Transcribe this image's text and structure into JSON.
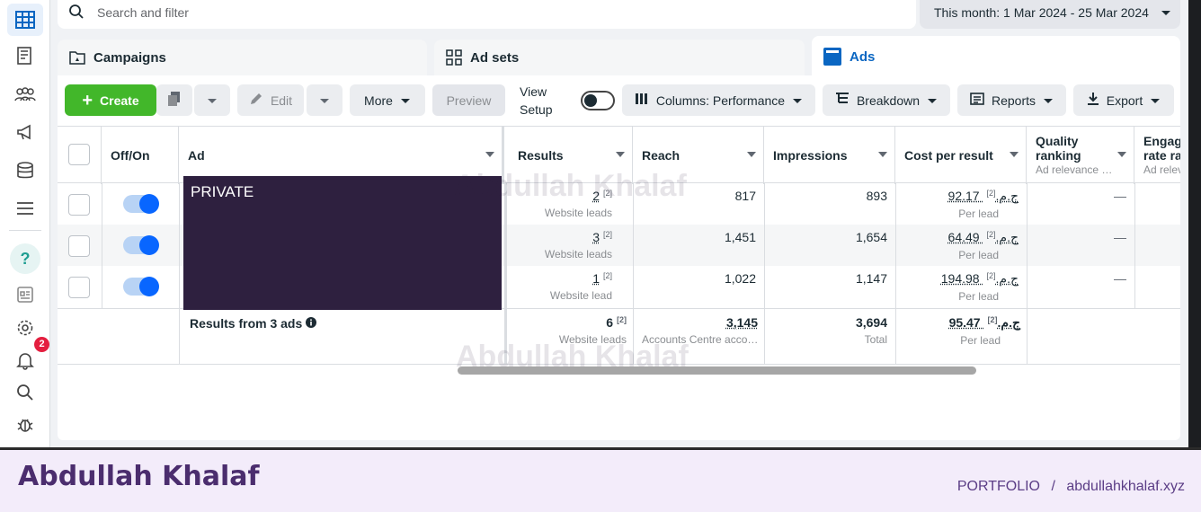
{
  "search": {
    "placeholder": "Search and filter"
  },
  "date_range": {
    "label": "This month: 1 Mar 2024 - 25 Mar 2024"
  },
  "tabs": [
    {
      "label": "Campaigns"
    },
    {
      "label": "Ad sets"
    },
    {
      "label": "Ads"
    }
  ],
  "toolbar": {
    "create": "Create",
    "edit": "Edit",
    "more": "More",
    "preview": "Preview",
    "view_setup": "View Setup",
    "columns": "Columns: Performance",
    "breakdown": "Breakdown",
    "reports": "Reports",
    "export": "Export"
  },
  "nav": {
    "notifications_count": "2"
  },
  "columns": {
    "off_on": "Off/On",
    "ad": "Ad",
    "results": "Results",
    "reach": "Reach",
    "impressions": "Impressions",
    "cost_per_result": "Cost per result",
    "quality": "Quality ranking",
    "quality_sub": "Ad relevance …",
    "engagement": "Engage rate ra",
    "engagement_sub": "Ad relev"
  },
  "private_label": "PRIVATE",
  "rows": [
    {
      "results": "2",
      "results_sub": "Website leads",
      "reach": "817",
      "impressions": "893",
      "cost": "92.17 ج.م.‏",
      "cost_sub": "Per lead",
      "quality": "—"
    },
    {
      "results": "3",
      "results_sub": "Website leads",
      "reach": "1,451",
      "impressions": "1,654",
      "cost": "64.49 ج.م.‏",
      "cost_sub": "Per lead",
      "quality": "—"
    },
    {
      "results": "1",
      "results_sub": "Website lead",
      "reach": "1,022",
      "impressions": "1,147",
      "cost": "194.98 ج.م.‏",
      "cost_sub": "Per lead",
      "quality": "—"
    }
  ],
  "footnote": "[2]",
  "totals": {
    "label": "Results from 3 ads",
    "results": "6",
    "results_sub": "Website leads",
    "reach": "3,145",
    "reach_sub": "Accounts Centre acco…",
    "impressions": "3,694",
    "impressions_sub": "Total",
    "cost": "95.47 ج.م.‏",
    "cost_sub": "Per lead"
  },
  "watermark": "Abdullah Khalaf",
  "footer": {
    "brand": "Abdullah Khalaf",
    "portfolio": "PORTFOLIO",
    "sep": "/",
    "site": "abdullahkhalaf.xyz"
  }
}
